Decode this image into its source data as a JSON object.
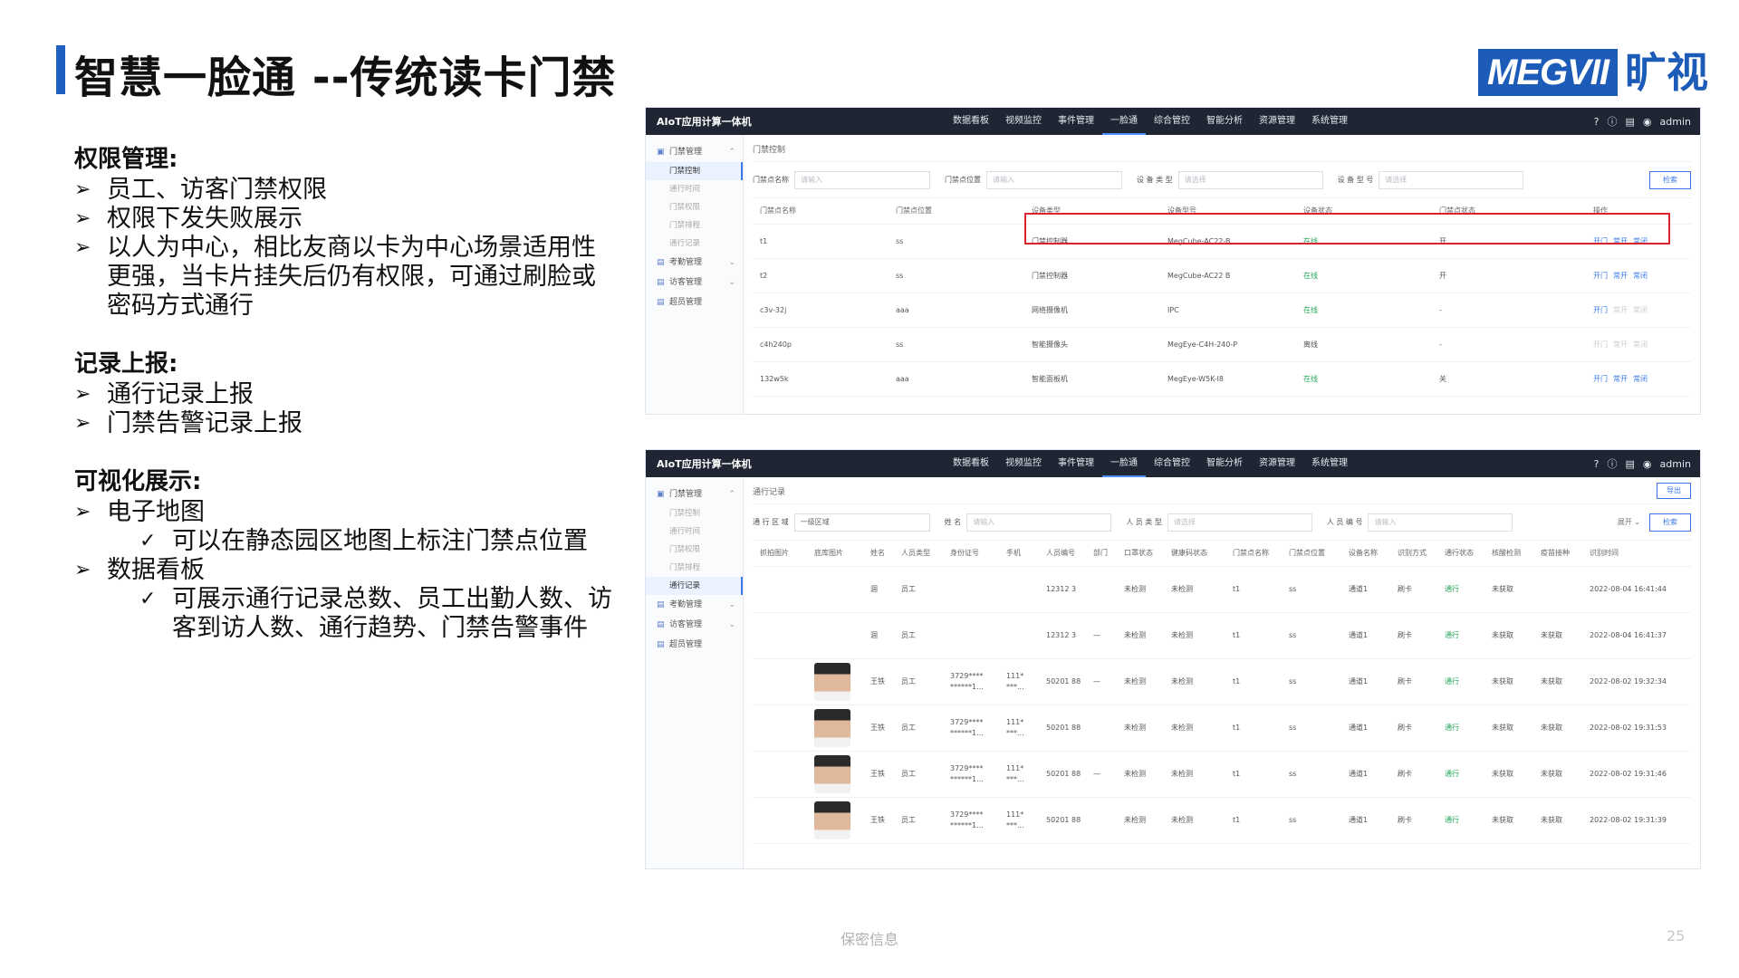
{
  "slide": {
    "title": "智慧一脸通 --传统读卡门禁",
    "logo_text": "MEGVII",
    "logo_cn": "旷视",
    "footer": "保密信息",
    "page_number": "25"
  },
  "sections": [
    {
      "heading": "权限管理:",
      "bullets": [
        "员工、访客门禁权限",
        "权限下发失败展示",
        "以人为中心，相比友商以卡为中心场景适用性",
        "更强，当卡片挂失后仍有权限，可通过刷脸或",
        "密码方式通行"
      ]
    },
    {
      "heading": "记录上报:",
      "bullets": [
        "通行记录上报",
        "门禁告警记录上报"
      ]
    },
    {
      "heading": "可视化展示:",
      "bullets": [
        "电子地图",
        "可以在静态园区地图上标注门禁点位置",
        "数据看板",
        "可展示通行记录总数、员工出勤人数、访",
        "客到访人数、通行趋势、门禁告警事件"
      ]
    }
  ],
  "app": {
    "brand": "AIoT应用计算一体机",
    "nav": [
      "数据看板",
      "视频监控",
      "事件管理",
      "一脸通",
      "综合管控",
      "智能分析",
      "资源管理",
      "系统管理"
    ],
    "user": "admin",
    "sidebar": {
      "group1": "门禁管理",
      "items": [
        "门禁控制",
        "通行时间",
        "门禁权限",
        "门禁排程",
        "通行记录"
      ],
      "group2": "考勤管理",
      "group3": "访客管理",
      "group4": "超员管理"
    }
  },
  "panel1": {
    "crumb": "门禁控制",
    "filters": [
      {
        "label": "门禁点名称",
        "placeholder": "请输入"
      },
      {
        "label": "门禁点位置",
        "placeholder": "请输入"
      },
      {
        "label": "设 备 类 型",
        "placeholder": "请选择"
      },
      {
        "label": "设 备 型 号",
        "placeholder": "请选择"
      }
    ],
    "search": "检索",
    "columns": [
      "门禁点名称",
      "门禁点位置",
      "设备类型",
      "设备型号",
      "设备状态",
      "门禁点状态",
      "操作"
    ],
    "rows": [
      [
        "t1",
        "ss",
        "门禁控制器",
        "MegCube-AC22-B",
        "在线",
        "开"
      ],
      [
        "t2",
        "ss",
        "门禁控制器",
        "MegCube-AC22 B",
        "在线",
        "开"
      ],
      [
        "c3v-32j",
        "aaa",
        "网络摄像机",
        "IPC",
        "在线",
        "-"
      ],
      [
        "c4h240p",
        "ss",
        "智能摄像头",
        "MegEye-C4H-240-P",
        "离线",
        "-"
      ],
      [
        "132w5k",
        "aaa",
        "智能面板机",
        "MegEye-W5K-I8",
        "在线",
        "关"
      ]
    ],
    "actions": [
      "开门",
      "常开",
      "常闭"
    ]
  },
  "panel2": {
    "crumb": "通行记录",
    "export": "导出",
    "filters": [
      {
        "label": "通 行 区 域",
        "placeholder": "一级区域"
      },
      {
        "label": "姓     名",
        "placeholder": "请输入"
      },
      {
        "label": "人 员 类 型",
        "placeholder": "请选择"
      },
      {
        "label": "人 员 编 号",
        "placeholder": "请输入"
      }
    ],
    "expand": "展开",
    "search": "检索",
    "columns": [
      "抓拍图片",
      "底库图片",
      "姓名",
      "人员类型",
      "身份证号",
      "手机",
      "人员编号",
      "部门",
      "口罩状态",
      "健康码状态",
      "门禁点名称",
      "门禁点位置",
      "设备名称",
      "识别方式",
      "通行状态",
      "核酸检测",
      "疫苗接种",
      "识别时间"
    ],
    "rows": [
      {
        "photo": false,
        "name": "涸",
        "type": "员工",
        "id": "",
        "phone": "",
        "no": "12312 3",
        "dept": "",
        "mask": "未检测",
        "health": "未检测",
        "door": "t1",
        "loc": "ss",
        "dev": "通道1",
        "method": "刷卡",
        "status": "通行",
        "nat": "未获取",
        "vac": "",
        "time": "2022-08-04 16:41:44"
      },
      {
        "photo": false,
        "name": "涸",
        "type": "员工",
        "id": "",
        "phone": "",
        "no": "12312 3",
        "dept": "—",
        "mask": "未检测",
        "health": "未检测",
        "door": "t1",
        "loc": "ss",
        "dev": "通道1",
        "method": "刷卡",
        "status": "通行",
        "nat": "未获取",
        "vac": "未获取",
        "time": "2022-08-04 16:41:37"
      },
      {
        "photo": true,
        "name": "王铁",
        "type": "员工",
        "id": "3729**** ******1...",
        "phone": "111* ***...",
        "no": "50201 88",
        "dept": "—",
        "mask": "未检测",
        "health": "未检测",
        "door": "t1",
        "loc": "ss",
        "dev": "通道1",
        "method": "刷卡",
        "status": "通行",
        "nat": "未获取",
        "vac": "未获取",
        "time": "2022-08-02 19:32:34"
      },
      {
        "photo": true,
        "name": "王铁",
        "type": "员工",
        "id": "3729**** ******1...",
        "phone": "111* ***...",
        "no": "50201 88",
        "dept": "",
        "mask": "未检测",
        "health": "未检测",
        "door": "t1",
        "loc": "ss",
        "dev": "通道1",
        "method": "刷卡",
        "status": "通行",
        "nat": "未获取",
        "vac": "未获取",
        "time": "2022-08-02 19:31:53"
      },
      {
        "photo": true,
        "name": "王铁",
        "type": "员工",
        "id": "3729**** ******1...",
        "phone": "111* ***...",
        "no": "50201 88",
        "dept": "—",
        "mask": "未检测",
        "health": "未检测",
        "door": "t1",
        "loc": "ss",
        "dev": "通道1",
        "method": "刷卡",
        "status": "通行",
        "nat": "未获取",
        "vac": "未获取",
        "time": "2022-08-02 19:31:46"
      },
      {
        "photo": true,
        "name": "王铁",
        "type": "员工",
        "id": "3729**** ******1...",
        "phone": "111* ***...",
        "no": "50201 88",
        "dept": "",
        "mask": "未检测",
        "health": "未检测",
        "door": "t1",
        "loc": "ss",
        "dev": "通道1",
        "method": "刷卡",
        "status": "通行",
        "nat": "未获取",
        "vac": "未获取",
        "time": "2022-08-02 19:31:39"
      }
    ]
  },
  "colors": {
    "accent": "#1f5fbf",
    "nav_bg": "#1f2533",
    "highlight": "#d9242b",
    "status_ok": "#25a55a"
  }
}
